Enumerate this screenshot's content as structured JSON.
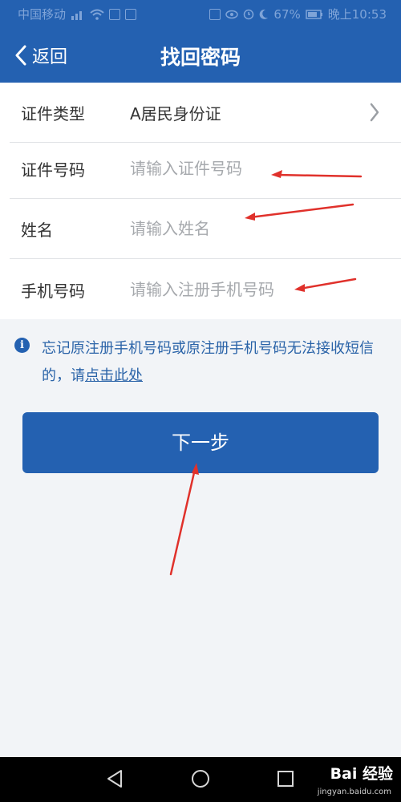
{
  "statusbar": {
    "carrier": "中国移动",
    "battery": "67%",
    "time": "晚上10:53"
  },
  "navbar": {
    "back_label": "返回",
    "title": "找回密码"
  },
  "form": {
    "id_type": {
      "label": "证件类型",
      "value": "A居民身份证"
    },
    "id_number": {
      "label": "证件号码",
      "placeholder": "请输入证件号码",
      "value": ""
    },
    "name": {
      "label": "姓名",
      "placeholder": "请输入姓名",
      "value": ""
    },
    "phone": {
      "label": "手机号码",
      "placeholder": "请输入注册手机号码",
      "value": ""
    }
  },
  "notice": {
    "text": "忘记原注册手机号码或原注册手机号码无法接收短信的，请",
    "link": "点击此处"
  },
  "next_button": {
    "label": "下一步"
  },
  "watermark": {
    "brand": "Bai  经验",
    "url": "jingyan.baidu.com"
  },
  "colors": {
    "brand_blue": "#2461b1",
    "notice_text": "#2a63a8",
    "annotation_red": "#e0312b"
  }
}
